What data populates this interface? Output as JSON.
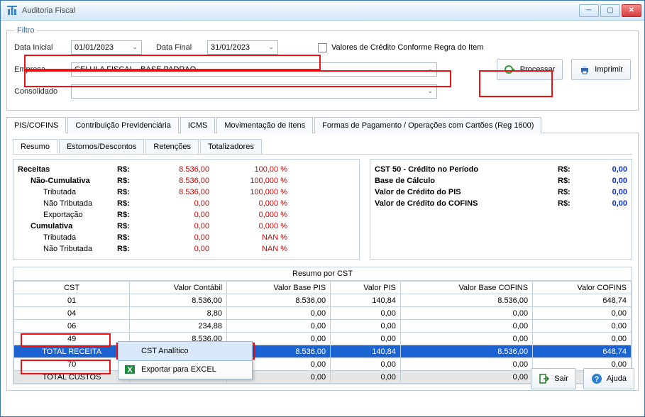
{
  "window": {
    "title": "Auditoria Fiscal"
  },
  "filter": {
    "legend": "Filtro",
    "data_inicial_label": "Data Inicial",
    "data_inicial_value": "01/01/2023",
    "data_final_label": "Data Final",
    "data_final_value": "31/01/2023",
    "credito_checkbox": "Valores de Crédito Conforme Regra do Item",
    "empresa_label": "Empresa",
    "empresa_value": "CELULA FISCAL - BASE PADRAO",
    "consolidado_label": "Consolidado",
    "consolidado_value": "",
    "processar": "Processar",
    "imprimir": "Imprimir"
  },
  "tabs": {
    "main": [
      "PIS/COFINS",
      "Contribuição Previdenciária",
      "ICMS",
      "Movimentação de Itens",
      "Formas de Pagamento / Operações com Cartões  (Reg 1600)"
    ],
    "sub": [
      "Resumo",
      "Estornos/Descontos",
      "Retenções",
      "Totalizadores"
    ]
  },
  "revenue": {
    "currency": "R$:",
    "rows": [
      {
        "name": "Receitas",
        "val": "8.536,00",
        "pct": "100,00 %",
        "bold": true,
        "red": true
      },
      {
        "name": "Não-Cumulativa",
        "val": "8.536,00",
        "pct": "100,000 %",
        "bold": true,
        "red": true,
        "indent": 1
      },
      {
        "name": "Tributada",
        "val": "8.536,00",
        "pct": "100,000 %",
        "red": true,
        "indent": 2
      },
      {
        "name": "Não Tributada",
        "val": "0,00",
        "pct": "0,000 %",
        "red": true,
        "indent": 2
      },
      {
        "name": "Exportação",
        "val": "0,00",
        "pct": "0,000 %",
        "red": true,
        "indent": 2
      },
      {
        "name": "Cumulativa",
        "val": "0,00",
        "pct": "0,000 %",
        "bold": true,
        "red": true,
        "indent": 1
      },
      {
        "name": "Tributada",
        "val": "0,00",
        "pct": "NAN %",
        "red": true,
        "indent": 2
      },
      {
        "name": "Não Tributada",
        "val": "0,00",
        "pct": "NAN %",
        "red": true,
        "indent": 2
      }
    ]
  },
  "credit": {
    "rows": [
      {
        "label": "CST 50 - Crédito no Período",
        "cur": "R$:",
        "val": "0,00"
      },
      {
        "label": "Base de Cálculo",
        "cur": "R$:",
        "val": "0,00"
      },
      {
        "label": "Valor de Crédito do PIS",
        "cur": "R$:",
        "val": "0,00"
      },
      {
        "label": "Valor de Crédito do COFINS",
        "cur": "R$:",
        "val": "0,00"
      }
    ]
  },
  "cst_grid": {
    "title": "Resumo por CST",
    "headers": [
      "CST",
      "Valor Contábil",
      "Valor Base PIS",
      "Valor PIS",
      "Valor Base COFINS",
      "Valor COFINS"
    ],
    "rows": [
      {
        "cells": [
          "01",
          "8.536,00",
          "8.536,00",
          "140,84",
          "8.536,00",
          "648,74"
        ]
      },
      {
        "cells": [
          "04",
          "8,80",
          "0,00",
          "0,00",
          "0,00",
          "0,00"
        ]
      },
      {
        "cells": [
          "06",
          "234,88",
          "0,00",
          "0,00",
          "0,00",
          "0,00"
        ]
      },
      {
        "cells": [
          "49",
          "8.536,00",
          "0,00",
          "0,00",
          "0,00",
          "0,00"
        ]
      },
      {
        "cells": [
          "TOTAL RECEITA",
          "",
          "8.536,00",
          "140,84",
          "8.536,00",
          "648,74"
        ],
        "sel": true
      },
      {
        "cells": [
          "70",
          "",
          "0,00",
          "0,00",
          "0,00",
          "0,00"
        ]
      },
      {
        "cells": [
          "TOTAL CUSTOS",
          "",
          "0,00",
          "0,00",
          "0,00",
          "0,00"
        ],
        "gray": true
      }
    ]
  },
  "context_menu": {
    "item1": "CST Analítico",
    "item2": "Exportar para EXCEL"
  },
  "footer": {
    "sair": "Sair",
    "ajuda": "Ajuda"
  }
}
